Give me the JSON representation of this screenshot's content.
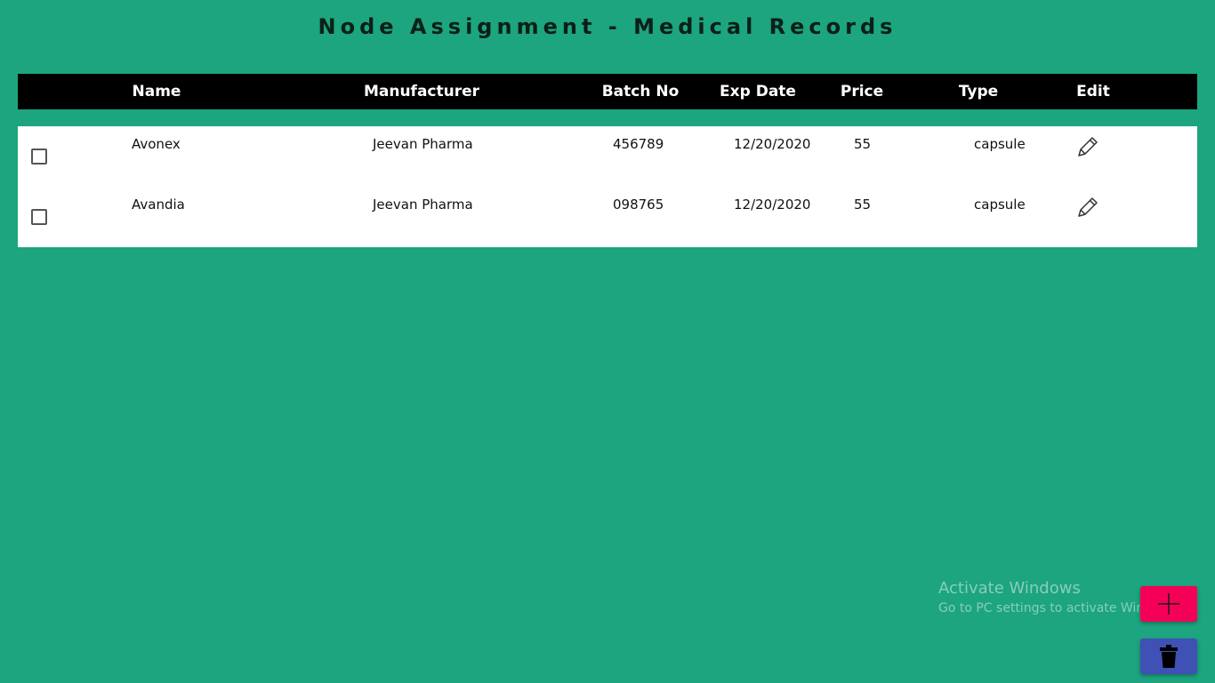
{
  "title": "Node Assignment - Medical Records",
  "columns": [
    "Name",
    "Manufacturer",
    "Batch No",
    "Exp Date",
    "Price",
    "Type",
    "Edit"
  ],
  "rows": [
    {
      "checked": false,
      "name": "Avonex",
      "manufacturer": "Jeevan Pharma",
      "batch_no": "456789",
      "exp_date": "12/20/2020",
      "price": "55",
      "type": "capsule",
      "edit_icon": "pencil-icon"
    },
    {
      "checked": false,
      "name": "Avandia",
      "manufacturer": "Jeevan Pharma",
      "batch_no": "098765",
      "exp_date": "12/20/2020",
      "price": "55",
      "type": "capsule",
      "edit_icon": "pencil-icon"
    }
  ],
  "watermark": {
    "title": "Activate Windows",
    "subtitle": "Go to PC settings to activate Windows."
  },
  "fab": {
    "add_icon": "plus-icon",
    "delete_icon": "trash-icon"
  },
  "colors": {
    "background": "#1ca57e",
    "header_bg": "#000000",
    "add_button": "#f50057",
    "delete_button": "#3f51b5"
  }
}
